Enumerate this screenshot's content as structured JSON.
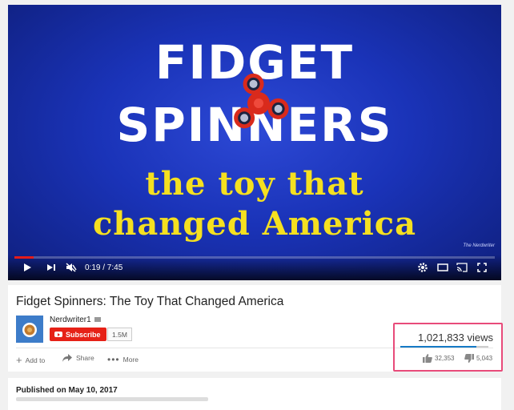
{
  "player": {
    "title_line1": "FIDGET",
    "title_line2": "SPINNERS",
    "subtitle_line1": "the toy that",
    "subtitle_line2": "changed America",
    "watermark": "The Nerdwriter",
    "current_time": "0:19",
    "duration": "7:45",
    "time_display": "0:19 / 7:45",
    "progress": 0.04,
    "colors": {
      "background": "#1a33b8",
      "title": "#ffffff",
      "subtitle": "#f5e020",
      "progress": "#e31b1b"
    }
  },
  "video": {
    "title": "Fidget Spinners: The Toy That Changed America",
    "channel": "Nerdwriter1",
    "subscribe_label": "Subscribe",
    "subscriber_count": "1.5M",
    "views": "1,021,833 views",
    "likes": "32,353",
    "dislikes": "5,043",
    "like_ratio": 0.865
  },
  "actions": {
    "add_to": "Add to",
    "share": "Share",
    "more": "More"
  },
  "description": {
    "published": "Published on May 10, 2017"
  }
}
